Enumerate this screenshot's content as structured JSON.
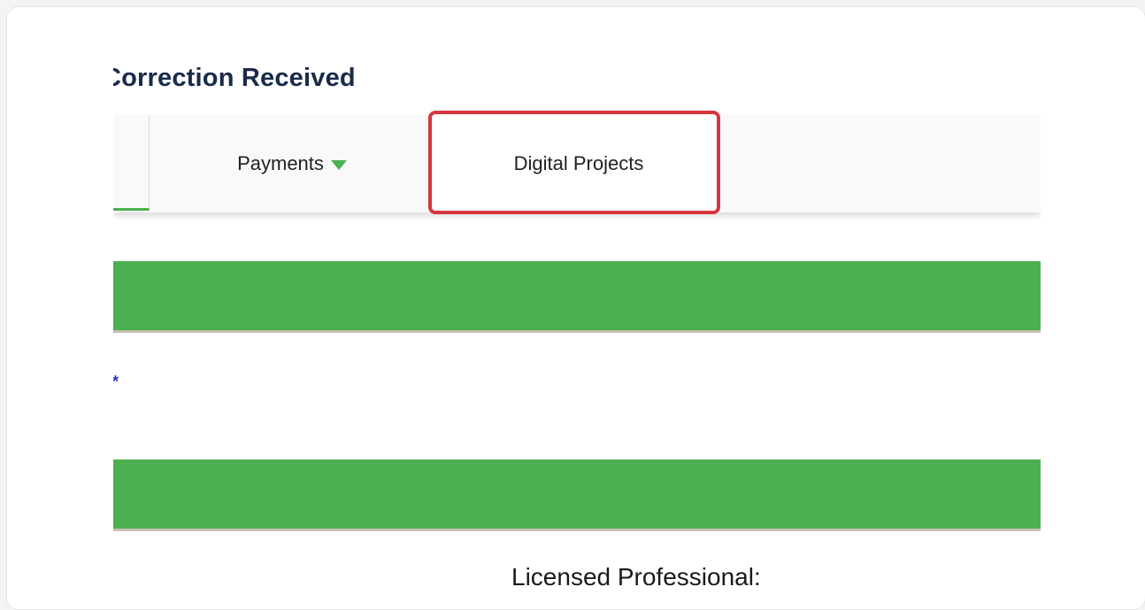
{
  "page": {
    "title": "Correction Received"
  },
  "tabs": {
    "payments_label": "Payments",
    "digital_projects_label": "Digital Projects"
  },
  "form": {
    "required_marker": ": *",
    "section_label": "Licensed Professional:"
  },
  "colors": {
    "accent": "#4caf50",
    "highlight": "#d6363e",
    "title": "#1a2a4a",
    "required": "#2233cc"
  },
  "icons": {
    "payments_dropdown": "caret-down-icon"
  }
}
